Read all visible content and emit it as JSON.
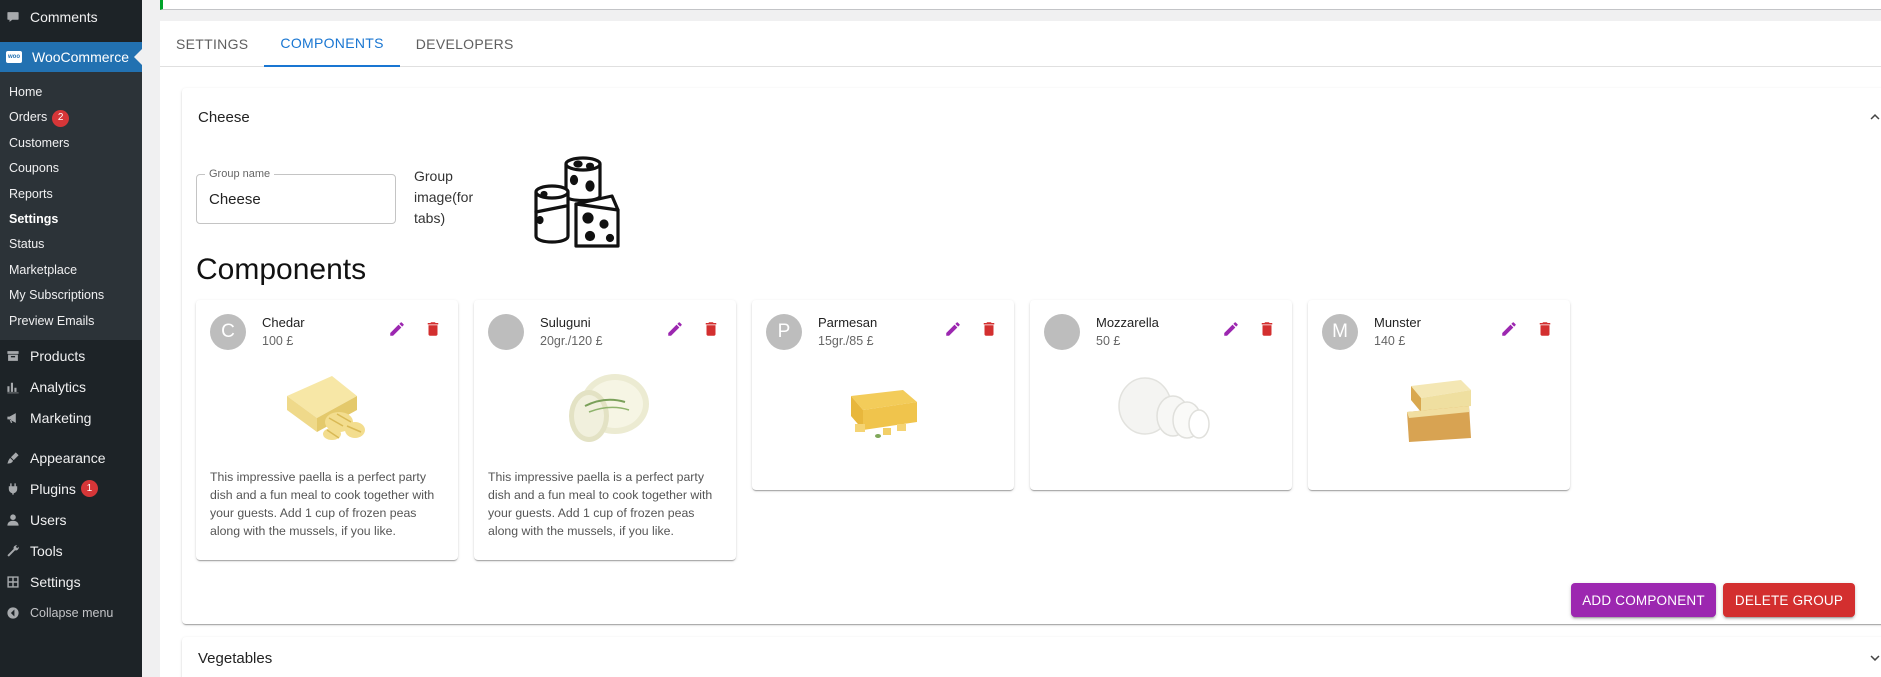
{
  "sidebar": {
    "top_items": [
      {
        "label": "Comments",
        "icon": "comment-icon"
      }
    ],
    "woocommerce": {
      "label": "WooCommerce",
      "badge_text": "woo"
    },
    "submenu": [
      {
        "label": "Home"
      },
      {
        "label": "Orders",
        "badge": "2"
      },
      {
        "label": "Customers"
      },
      {
        "label": "Coupons"
      },
      {
        "label": "Reports"
      },
      {
        "label": "Settings"
      },
      {
        "label": "Status"
      },
      {
        "label": "Marketplace"
      },
      {
        "label": "My Subscriptions"
      },
      {
        "label": "Preview Emails"
      }
    ],
    "lower_items": [
      {
        "label": "Products",
        "icon": "archive-icon"
      },
      {
        "label": "Analytics",
        "icon": "bar-chart-icon"
      },
      {
        "label": "Marketing",
        "icon": "megaphone-icon"
      },
      {
        "label": "Appearance",
        "icon": "paintbrush-icon"
      },
      {
        "label": "Plugins",
        "icon": "plug-icon",
        "badge": "1"
      },
      {
        "label": "Users",
        "icon": "user-icon"
      },
      {
        "label": "Tools",
        "icon": "wrench-icon"
      },
      {
        "label": "Settings",
        "icon": "settings-icon"
      },
      {
        "label": "Collapse menu",
        "icon": "collapse-icon"
      }
    ]
  },
  "tabs": [
    {
      "label": "SETTINGS"
    },
    {
      "label": "COMPONENTS"
    },
    {
      "label": "DEVELOPERS"
    }
  ],
  "groups": [
    {
      "title": "Cheese",
      "group_name_label": "Group name",
      "group_name_value": "Cheese",
      "group_image_label": "Group image(for tabs)",
      "components_heading": "Components",
      "components": [
        {
          "avatar": "C",
          "name": "Chedar",
          "price": "100 £",
          "description": "This impressive paella is a perfect party dish and a fun meal to cook together with your guests. Add 1 cup of frozen peas along with the mussels, if you like."
        },
        {
          "avatar": "",
          "name": "Suluguni",
          "price": "20gr./120 £",
          "description": "This impressive paella is a perfect party dish and a fun meal to cook together with your guests. Add 1 cup of frozen peas along with the mussels, if you like."
        },
        {
          "avatar": "P",
          "name": "Parmesan",
          "price": "15gr./85 £",
          "description": ""
        },
        {
          "avatar": "",
          "name": "Mozzarella",
          "price": "50 £",
          "description": ""
        },
        {
          "avatar": "M",
          "name": "Munster",
          "price": "140 £",
          "description": ""
        }
      ],
      "add_component_label": "ADD COMPONENT",
      "delete_group_label": "DELETE GROUP"
    },
    {
      "title": "Vegetables"
    }
  ],
  "colors": {
    "sidebar_bg": "#1d2327",
    "accent_blue": "#2271b1",
    "tab_active": "#1976d2",
    "edit_purple": "#9c27b0",
    "delete_red": "#d32f2f"
  }
}
